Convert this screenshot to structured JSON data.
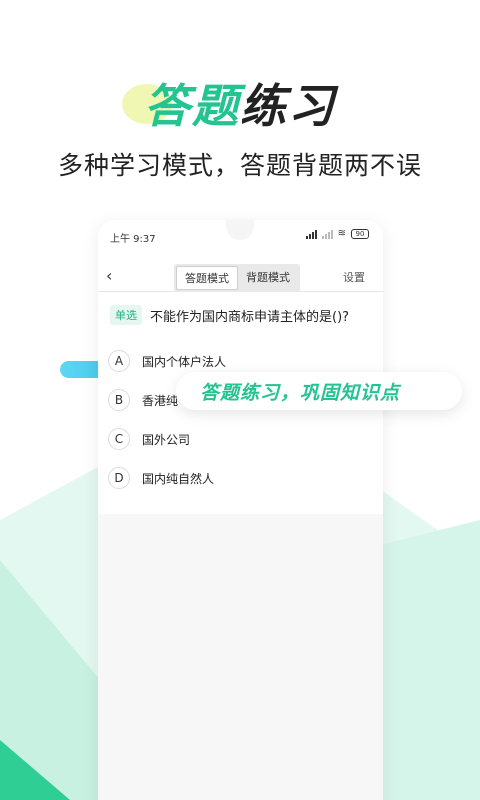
{
  "promo": {
    "title_accent": "答题",
    "title_rest": "练习",
    "subtitle": "多种学习模式，答题背题两不误",
    "callout": "答题练习，巩固知识点"
  },
  "colors": {
    "accent": "#23c490",
    "blob": "#f0f7b2",
    "pill": "#3ec8e9"
  },
  "phone": {
    "status": {
      "time": "上午 9:37",
      "battery": "90"
    },
    "nav": {
      "back_icon": "chevron-left-icon",
      "back_glyph": "‹",
      "tabs": [
        "答题模式",
        "背题模式"
      ],
      "active_tab": 0,
      "settings": "设置"
    },
    "question": {
      "type_badge": "单选",
      "text": "不能作为国内商标申请主体的是()?"
    },
    "options": [
      {
        "letter": "A",
        "text": "国内个体户法人"
      },
      {
        "letter": "B",
        "text": "香港纯"
      },
      {
        "letter": "C",
        "text": "国外公司"
      },
      {
        "letter": "D",
        "text": "国内纯自然人"
      }
    ]
  }
}
